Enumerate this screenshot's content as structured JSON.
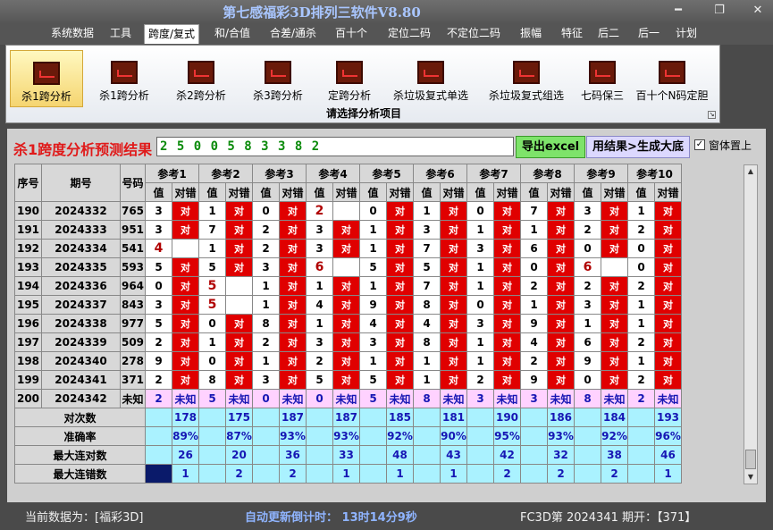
{
  "window": {
    "title": "第七感福彩3D排列三软件V8.80",
    "min": "━",
    "max": "❐",
    "close": "✕"
  },
  "menu": [
    "系统数据",
    "工具",
    "跨度/复式",
    "和/合值",
    "合差/通杀",
    "百十个",
    "定位二码",
    "不定位二码",
    "振幅",
    "特征",
    "后二",
    "后一",
    "计划"
  ],
  "menu_active": 2,
  "ribbon": {
    "buttons": [
      "杀1跨分析",
      "杀1跨分析",
      "杀2跨分析",
      "杀3跨分析",
      "定跨分析",
      "杀垃圾复式单选",
      "杀垃圾复式组选",
      "七码保三",
      "百十个N码定胆"
    ],
    "selected": 0,
    "caption": "请选择分析项目",
    "icon": "chart-icon"
  },
  "panel": {
    "title": "杀1跨度分析预测结果",
    "result": "2 5 0 0 5 8 3 3 8 2",
    "excel_btn": "导出excel",
    "gen_btn": "用结果>生成大底",
    "topmost_label": "窗体置上",
    "topmost_checked": "✓"
  },
  "table": {
    "col_seq": "序号",
    "col_issue": "期号",
    "col_num": "号码",
    "refs": [
      "参考1",
      "参考2",
      "参考3",
      "参考4",
      "参考5",
      "参考6",
      "参考7",
      "参考8",
      "参考9",
      "参考10"
    ],
    "sub_val": "值",
    "sub_ok": "对错",
    "hit": "对",
    "rows": [
      {
        "seq": "190",
        "issue": "2024332",
        "num": "765",
        "vals": [
          "3",
          "1",
          "0",
          "2",
          "0",
          "1",
          "0",
          "7",
          "3",
          "1"
        ],
        "hits": [
          1,
          1,
          1,
          0,
          1,
          1,
          1,
          1,
          1,
          1
        ]
      },
      {
        "seq": "191",
        "issue": "2024333",
        "num": "951",
        "vals": [
          "3",
          "7",
          "2",
          "3",
          "1",
          "3",
          "1",
          "1",
          "2",
          "2"
        ],
        "hits": [
          1,
          1,
          1,
          1,
          1,
          1,
          1,
          1,
          1,
          1
        ]
      },
      {
        "seq": "192",
        "issue": "2024334",
        "num": "541",
        "vals": [
          "4",
          "1",
          "2",
          "3",
          "1",
          "7",
          "3",
          "6",
          "0",
          "0"
        ],
        "hits": [
          0,
          1,
          1,
          1,
          1,
          1,
          1,
          1,
          1,
          1
        ]
      },
      {
        "seq": "193",
        "issue": "2024335",
        "num": "593",
        "vals": [
          "5",
          "5",
          "3",
          "6",
          "5",
          "5",
          "1",
          "0",
          "6",
          "0"
        ],
        "hits": [
          1,
          1,
          1,
          0,
          1,
          1,
          1,
          1,
          0,
          1
        ]
      },
      {
        "seq": "194",
        "issue": "2024336",
        "num": "964",
        "vals": [
          "0",
          "5",
          "1",
          "1",
          "1",
          "7",
          "1",
          "2",
          "2",
          "2"
        ],
        "hits": [
          1,
          0,
          1,
          1,
          1,
          1,
          1,
          1,
          1,
          1
        ]
      },
      {
        "seq": "195",
        "issue": "2024337",
        "num": "843",
        "vals": [
          "3",
          "5",
          "1",
          "4",
          "9",
          "8",
          "0",
          "1",
          "3",
          "1"
        ],
        "hits": [
          1,
          0,
          1,
          1,
          1,
          1,
          1,
          1,
          1,
          1
        ]
      },
      {
        "seq": "196",
        "issue": "2024338",
        "num": "977",
        "vals": [
          "5",
          "0",
          "8",
          "1",
          "4",
          "4",
          "3",
          "9",
          "1",
          "1"
        ],
        "hits": [
          1,
          1,
          1,
          1,
          1,
          1,
          1,
          1,
          1,
          1
        ]
      },
      {
        "seq": "197",
        "issue": "2024339",
        "num": "509",
        "vals": [
          "2",
          "1",
          "2",
          "3",
          "3",
          "8",
          "1",
          "4",
          "6",
          "2"
        ],
        "hits": [
          1,
          1,
          1,
          1,
          1,
          1,
          1,
          1,
          1,
          1
        ]
      },
      {
        "seq": "198",
        "issue": "2024340",
        "num": "278",
        "vals": [
          "9",
          "0",
          "1",
          "2",
          "1",
          "1",
          "1",
          "2",
          "9",
          "1"
        ],
        "hits": [
          1,
          1,
          1,
          1,
          1,
          1,
          1,
          1,
          1,
          1
        ]
      },
      {
        "seq": "199",
        "issue": "2024341",
        "num": "371",
        "vals": [
          "2",
          "8",
          "3",
          "5",
          "5",
          "1",
          "2",
          "9",
          "0",
          "2"
        ],
        "hits": [
          1,
          1,
          1,
          1,
          1,
          1,
          1,
          1,
          1,
          1
        ]
      }
    ],
    "big_vals": [
      [
        0,
        3
      ],
      [
        2,
        0
      ],
      [
        3,
        3
      ],
      [
        3,
        8
      ],
      [
        4,
        1
      ],
      [
        5,
        1
      ]
    ],
    "last": {
      "seq": "200",
      "issue": "2024342",
      "num": "未知",
      "vals": [
        "2",
        "5",
        "0",
        "0",
        "5",
        "8",
        "3",
        "3",
        "8",
        "2"
      ],
      "unknown": "未知"
    },
    "stats": [
      {
        "label": "对次数",
        "vals": [
          "178",
          "175",
          "187",
          "187",
          "185",
          "181",
          "190",
          "186",
          "184",
          "193"
        ]
      },
      {
        "label": "准确率",
        "vals": [
          "89%",
          "87%",
          "93%",
          "93%",
          "92%",
          "90%",
          "95%",
          "93%",
          "92%",
          "96%"
        ]
      },
      {
        "label": "最大连对数",
        "vals": [
          "26",
          "20",
          "36",
          "33",
          "48",
          "43",
          "42",
          "32",
          "38",
          "46"
        ]
      },
      {
        "label": "最大连错数",
        "vals": [
          "1",
          "2",
          "2",
          "1",
          "1",
          "1",
          "2",
          "2",
          "2",
          "1"
        ]
      }
    ]
  },
  "status": {
    "current": "当前数据为：[福彩3D]",
    "countdown": "自动更新倒计时： 13时14分9秒",
    "draw": "FC3D第 2024341 期开：【371】"
  }
}
